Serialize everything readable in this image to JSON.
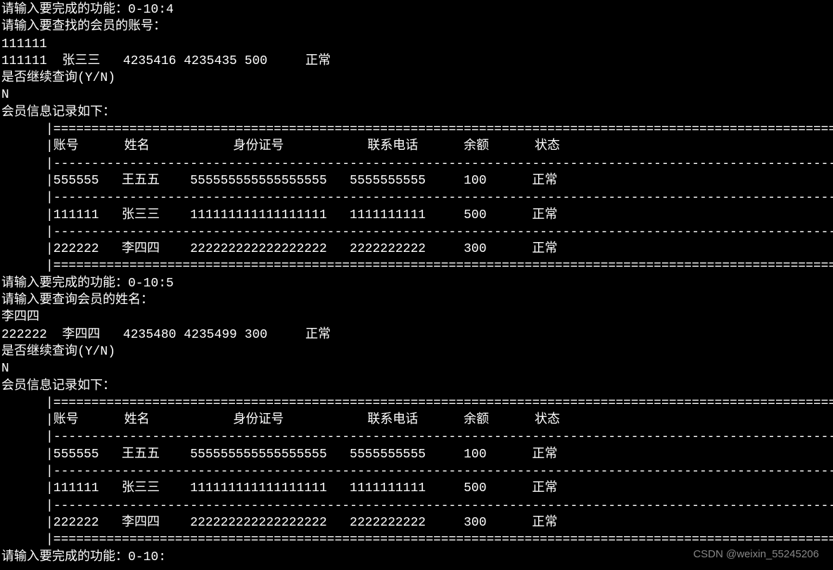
{
  "prompts": {
    "func_prompt_4": "请输入要完成的功能：0-10:4",
    "search_account_prompt": "请输入要查找的会员的账号：",
    "account_input": "111111",
    "result1": "111111  张三三   4235416 4235435 500     正常",
    "continue_prompt": "是否继续查询(Y/N)",
    "continue_answer": "N",
    "list_header": "会员信息记录如下：",
    "func_prompt_5": "请输入要完成的功能：0-10:5",
    "search_name_prompt": "请输入要查询会员的姓名：",
    "name_input": "李四四",
    "result2": "222222  李四四   4235480 4235499 300     正常",
    "func_prompt_end": "请输入要完成的功能：0-10:"
  },
  "table": {
    "border_top": "|=======================================================================================================|",
    "border_dash": "|-------------------------------------------------------------------------------------------------------|",
    "header": "|账号      姓名           身份证号           联系电话      余额      状态",
    "row1": "|555555   王五五    555555555555555555   5555555555     100      正常",
    "row2": "|111111   张三三    111111111111111111   1111111111     500      正常",
    "row3": "|222222   李四四    222222222222222222   2222222222     300      正常"
  },
  "watermark": "CSDN @weixin_55245206"
}
